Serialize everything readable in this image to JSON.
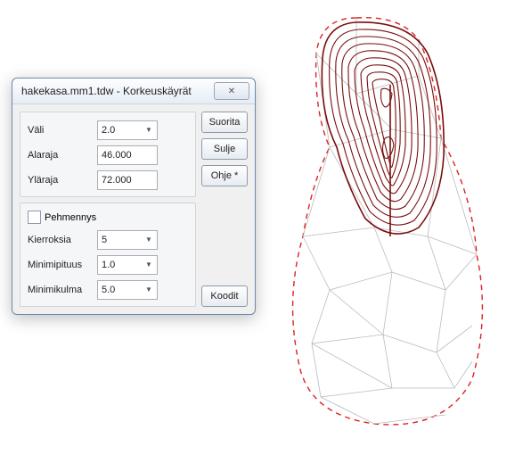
{
  "dialog": {
    "title": "hakekasa.mm1.tdw - Korkeuskäyrät",
    "group1": {
      "vali_label": "Väli",
      "vali_value": "2.0",
      "alaraja_label": "Alaraja",
      "alaraja_value": "46.000",
      "ylaraja_label": "Yläraja",
      "ylaraja_value": "72.000"
    },
    "group2": {
      "pehmennys_label": "Pehmennys",
      "kierroksia_label": "Kierroksia",
      "kierroksia_value": "5",
      "minimipituus_label": "Minimipituus",
      "minimipituus_value": "1.0",
      "minimikulma_label": "Minimikulma",
      "minimikulma_value": "5.0"
    },
    "buttons": {
      "suorita": "Suorita",
      "sulje": "Sulje",
      "ohje": "Ohje *",
      "koodit": "Koodit"
    }
  }
}
